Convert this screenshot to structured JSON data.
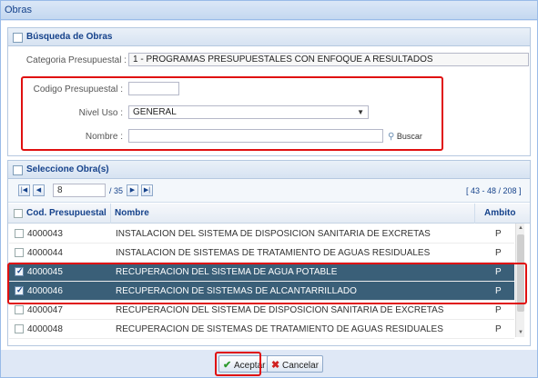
{
  "window": {
    "title": "Obras"
  },
  "search": {
    "title": "Búsqueda de Obras",
    "categoria_label": "Categoria Presupuestal :",
    "categoria_value": "1 - PROGRAMAS PRESUPUESTALES CON ENFOQUE A RESULTADOS",
    "codigo_label": "Codigo Presupuestal :",
    "codigo_value": "",
    "nivel_label": "Nivel Uso :",
    "nivel_value": "GENERAL",
    "nombre_label": "Nombre :",
    "nombre_value": "",
    "buscar_label": "Buscar"
  },
  "select": {
    "title": "Seleccione Obra(s)",
    "pager": {
      "page": "8",
      "total": "/ 35",
      "range": "[ 43 - 48 / 208 ]"
    },
    "columns": {
      "code": "Cod. Presupuestal",
      "name": "Nombre",
      "scope": "Ambito"
    },
    "rows": [
      {
        "code": "4000043",
        "name": "INSTALACION DEL SISTEMA DE DISPOSICION SANITARIA DE EXCRETAS",
        "scope": "P",
        "checked": false
      },
      {
        "code": "4000044",
        "name": "INSTALACION DE SISTEMAS DE TRATAMIENTO DE AGUAS RESIDUALES",
        "scope": "P",
        "checked": false
      },
      {
        "code": "4000045",
        "name": "RECUPERACION DEL SISTEMA DE AGUA POTABLE",
        "scope": "P",
        "checked": true
      },
      {
        "code": "4000046",
        "name": "RECUPERACION DE SISTEMAS DE ALCANTARRILLADO",
        "scope": "P",
        "checked": true
      },
      {
        "code": "4000047",
        "name": "RECUPERACION DEL SISTEMA DE DISPOSICION SANITARIA DE EXCRETAS",
        "scope": "P",
        "checked": false
      },
      {
        "code": "4000048",
        "name": "RECUPERACION DE SISTEMAS DE TRATAMIENTO DE AGUAS RESIDUALES",
        "scope": "P",
        "checked": false
      }
    ]
  },
  "footer": {
    "accept_label": "Aceptar",
    "cancel_label": "Cancelar"
  },
  "colors": {
    "selected_row": "#3a5f78",
    "highlight": "#e01010",
    "header_text": "#15428b"
  }
}
